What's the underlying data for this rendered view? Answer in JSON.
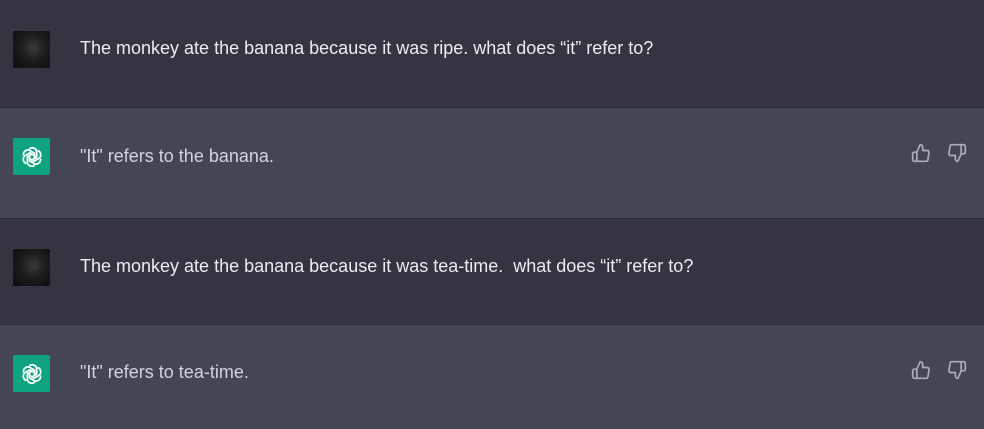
{
  "messages": [
    {
      "role": "user",
      "text": "The monkey ate the banana because it was ripe. what does “it” refer to?"
    },
    {
      "role": "assistant",
      "text": "\"It\" refers to the banana."
    },
    {
      "role": "user",
      "text": "The monkey ate the banana because it was tea-time.  what does “it” refer to?"
    },
    {
      "role": "assistant",
      "text": "\"It\" refers to tea-time."
    }
  ],
  "icons": {
    "user_avatar": "user-avatar",
    "assistant_avatar": "openai-logo-icon",
    "thumbs_up": "thumbs-up-icon",
    "thumbs_down": "thumbs-down-icon"
  },
  "colors": {
    "user_bg": "#343541",
    "assistant_bg": "#444654",
    "brand": "#10a37f"
  }
}
